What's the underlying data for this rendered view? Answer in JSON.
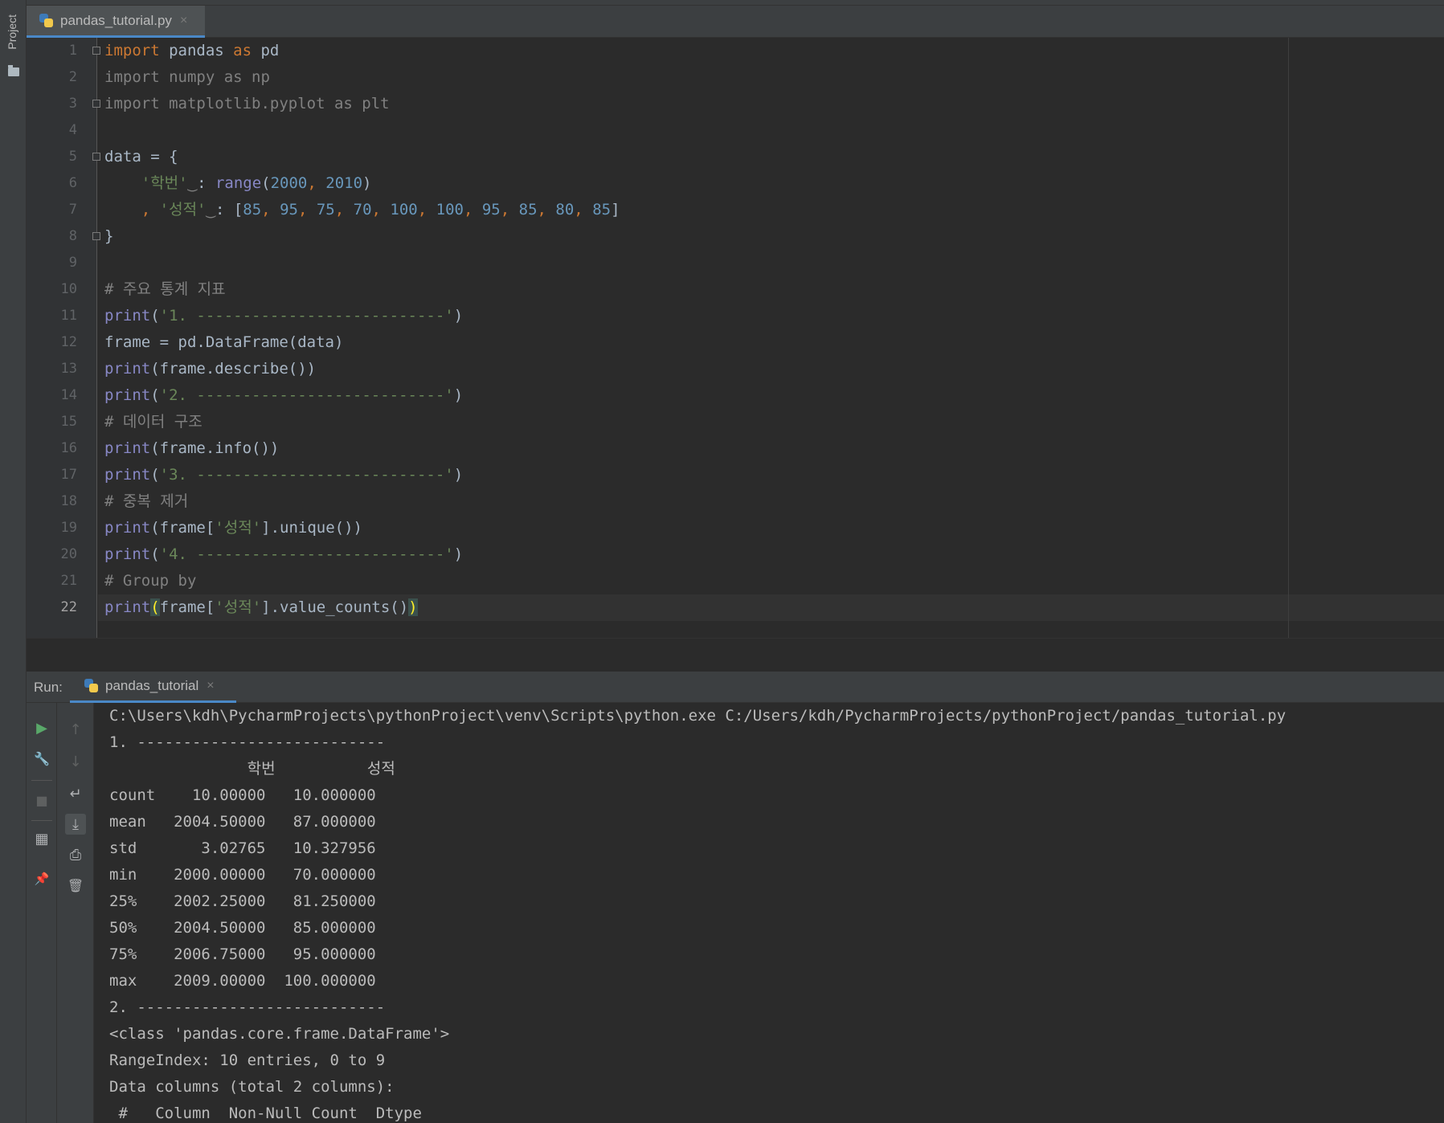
{
  "sidebar": {
    "project_label": "Project"
  },
  "editor_tab": {
    "filename": "pandas_tutorial.py",
    "close": "×"
  },
  "editor": {
    "active_line": 22,
    "line_numbers": [
      "1",
      "2",
      "3",
      "4",
      "5",
      "6",
      "7",
      "8",
      "9",
      "10",
      "11",
      "12",
      "13",
      "14",
      "15",
      "16",
      "17",
      "18",
      "19",
      "20",
      "21",
      "22"
    ],
    "lines": [
      [
        [
          "kw",
          "import"
        ],
        [
          "plain",
          " pandas "
        ],
        [
          "kw",
          "as"
        ],
        [
          "plain",
          " pd"
        ]
      ],
      [
        [
          "dim",
          "import numpy as np"
        ]
      ],
      [
        [
          "dim",
          "import matplotlib.pyplot as plt"
        ]
      ],
      [],
      [
        [
          "plain",
          "data = {"
        ]
      ],
      [
        [
          "plain",
          "    "
        ],
        [
          "str",
          "'학번'"
        ],
        [
          "dim",
          "‿"
        ],
        [
          "plain",
          ": "
        ],
        [
          "builtin",
          "range"
        ],
        [
          "plain",
          "("
        ],
        [
          "num",
          "2000"
        ],
        [
          "kw",
          ", "
        ],
        [
          "num",
          "2010"
        ],
        [
          "plain",
          ")"
        ]
      ],
      [
        [
          "plain",
          "    "
        ],
        [
          "kw",
          ", "
        ],
        [
          "str",
          "'성적'"
        ],
        [
          "dim",
          "‿"
        ],
        [
          "plain",
          ": ["
        ],
        [
          "num",
          "85"
        ],
        [
          "kw",
          ", "
        ],
        [
          "num",
          "95"
        ],
        [
          "kw",
          ", "
        ],
        [
          "num",
          "75"
        ],
        [
          "kw",
          ", "
        ],
        [
          "num",
          "70"
        ],
        [
          "kw",
          ", "
        ],
        [
          "num",
          "100"
        ],
        [
          "kw",
          ", "
        ],
        [
          "num",
          "100"
        ],
        [
          "kw",
          ", "
        ],
        [
          "num",
          "95"
        ],
        [
          "kw",
          ", "
        ],
        [
          "num",
          "85"
        ],
        [
          "kw",
          ", "
        ],
        [
          "num",
          "80"
        ],
        [
          "kw",
          ", "
        ],
        [
          "num",
          "85"
        ],
        [
          "plain",
          "]"
        ]
      ],
      [
        [
          "plain",
          "}"
        ]
      ],
      [],
      [
        [
          "cmt",
          "# 주요 통계 지표"
        ]
      ],
      [
        [
          "builtin",
          "print"
        ],
        [
          "plain",
          "("
        ],
        [
          "str",
          "'1. ---------------------------'"
        ],
        [
          "plain",
          ")"
        ]
      ],
      [
        [
          "plain",
          "frame = pd.DataFrame(data)"
        ]
      ],
      [
        [
          "builtin",
          "print"
        ],
        [
          "plain",
          "(frame.describe())"
        ]
      ],
      [
        [
          "builtin",
          "print"
        ],
        [
          "plain",
          "("
        ],
        [
          "str",
          "'2. ---------------------------'"
        ],
        [
          "plain",
          ")"
        ]
      ],
      [
        [
          "cmt",
          "# 데이터 구조"
        ]
      ],
      [
        [
          "builtin",
          "print"
        ],
        [
          "plain",
          "(frame.info())"
        ]
      ],
      [
        [
          "builtin",
          "print"
        ],
        [
          "plain",
          "("
        ],
        [
          "str",
          "'3. ---------------------------'"
        ],
        [
          "plain",
          ")"
        ]
      ],
      [
        [
          "cmt",
          "# 중복 제거"
        ]
      ],
      [
        [
          "builtin",
          "print"
        ],
        [
          "plain",
          "(frame["
        ],
        [
          "str",
          "'성적'"
        ],
        [
          "plain",
          "].unique())"
        ]
      ],
      [
        [
          "builtin",
          "print"
        ],
        [
          "plain",
          "("
        ],
        [
          "str",
          "'4. ---------------------------'"
        ],
        [
          "plain",
          ")"
        ]
      ],
      [
        [
          "cmt",
          "# Group by"
        ]
      ],
      [
        [
          "builtin",
          "print"
        ],
        [
          "brace-hl",
          "("
        ],
        [
          "plain",
          "frame["
        ],
        [
          "str",
          "'성적'"
        ],
        [
          "plain",
          "].value_counts()"
        ],
        [
          "brace-hl",
          ")"
        ]
      ]
    ]
  },
  "run": {
    "label": "Run:",
    "tab_name": "pandas_tutorial",
    "close": "×",
    "output": [
      "C:\\Users\\kdh\\PycharmProjects\\pythonProject\\venv\\Scripts\\python.exe C:/Users/kdh/PycharmProjects/pythonProject/pandas_tutorial.py",
      "1. ---------------------------",
      "               학번          성적",
      "count    10.00000   10.000000",
      "mean   2004.50000   87.000000",
      "std       3.02765   10.327956",
      "min    2000.00000   70.000000",
      "25%    2002.25000   81.250000",
      "50%    2004.50000   85.000000",
      "75%    2006.75000   95.000000",
      "max    2009.00000  100.000000",
      "2. ---------------------------",
      "<class 'pandas.core.frame.DataFrame'>",
      "RangeIndex: 10 entries, 0 to 9",
      "Data columns (total 2 columns):",
      " #   Column  Non-Null Count  Dtype"
    ]
  },
  "icons": {
    "run": "▶",
    "wrench": "🔧",
    "stop": "■",
    "layout": "▦",
    "pin": "📌",
    "up": "↑",
    "down": "↓",
    "soft_wrap": "↵",
    "scroll_end": "⤓",
    "print": "⎙",
    "trash": "🗑"
  }
}
